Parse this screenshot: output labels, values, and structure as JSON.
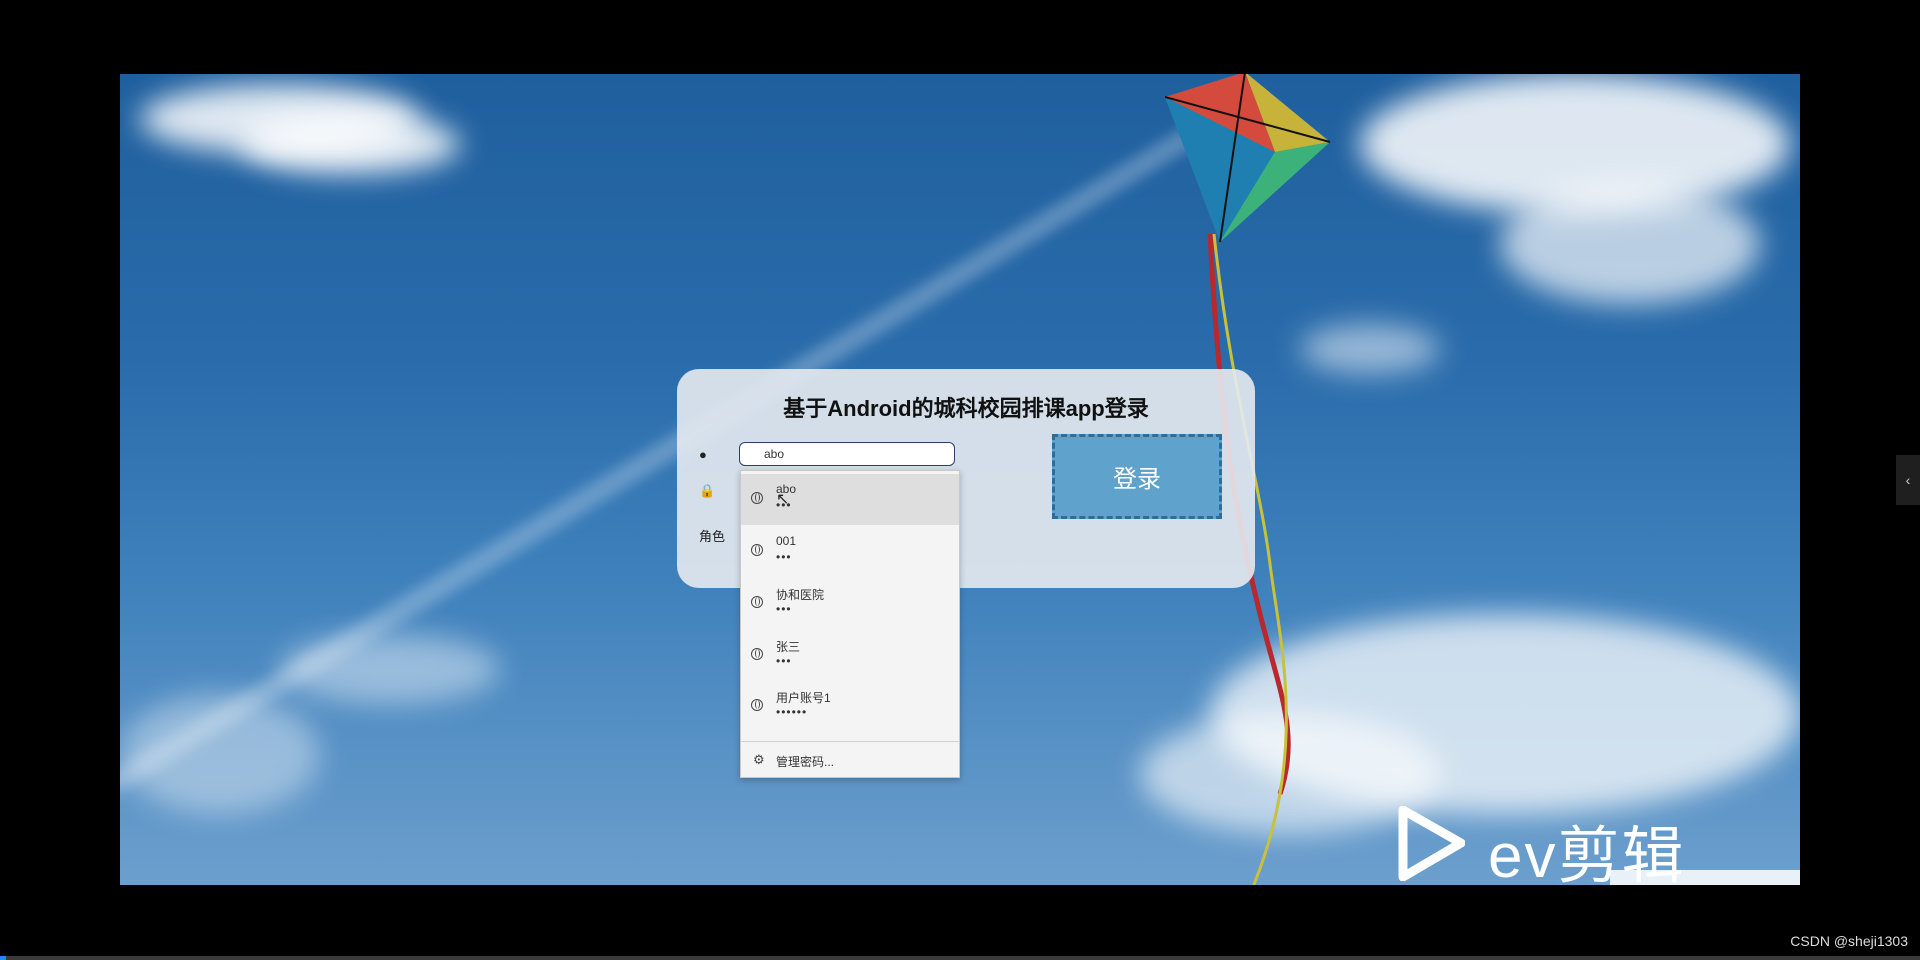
{
  "panel": {
    "title": "基于Android的城科校园排课app登录",
    "user_icon": "person-icon",
    "lock_icon": "lock-icon",
    "role_label": "角色",
    "username_value": "abo",
    "login_label": "登录"
  },
  "autofill": {
    "entries": [
      {
        "user": "abo",
        "pass": "•••"
      },
      {
        "user": "001",
        "pass": "•••"
      },
      {
        "user": "协和医院",
        "pass": "•••"
      },
      {
        "user": "张三",
        "pass": "•••"
      },
      {
        "user": "用户账号1",
        "pass": "••••••"
      }
    ],
    "manage_label": "管理密码..."
  },
  "watermark": {
    "text": "ev剪辑"
  },
  "credit": "CSDN @sheji1303",
  "side_tab_icon": "chevron-left-icon",
  "video_progress": 0.003,
  "colors": {
    "login_button": "#5fa3cc",
    "sky": "#2a6cab",
    "panel_bg": "#e6eaf0"
  }
}
